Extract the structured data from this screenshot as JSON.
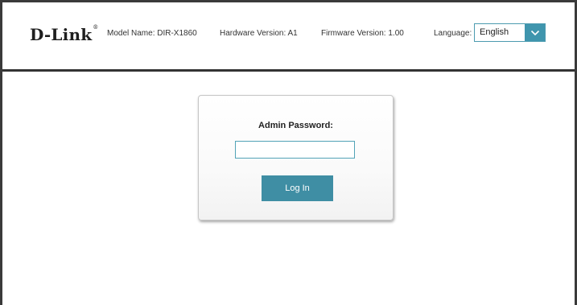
{
  "brand": {
    "logo_text": "D-Link",
    "logo_mark": "®"
  },
  "header": {
    "model_name": "Model Name: DIR-X1860",
    "hardware_version": "Hardware Version: A1",
    "firmware_version": "Firmware Version: 1.00",
    "language_label": "Language:",
    "language_value": "English",
    "dropdown_icon": "chevron-down-icon"
  },
  "login": {
    "label": "Admin Password:",
    "password_value": "",
    "button_label": "Log In"
  },
  "colors": {
    "accent": "#3f8ea4",
    "input_border": "#52a3b7",
    "frame": "#333333"
  }
}
